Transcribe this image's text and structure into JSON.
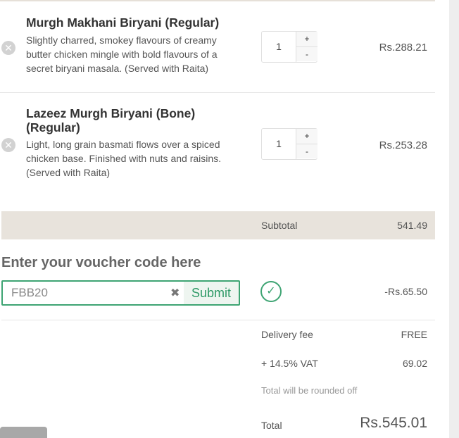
{
  "cart": {
    "items": [
      {
        "title": "Murgh Makhani Biryani (Regular)",
        "description": "Slightly charred, smokey flavours of creamy butter chicken mingle with bold flavours of a secret biryani masala. (Served with Raita)",
        "quantity": "1",
        "price": "Rs.288.21",
        "plus": "+",
        "minus": "-",
        "remove_icon": "close-circle-icon"
      },
      {
        "title": "Lazeez Murgh Biryani (Bone) (Regular)",
        "description": "Light, long grain basmati flows over a spiced chicken base. Finished with nuts and raisins. (Served with Raita)",
        "quantity": "1",
        "price": "Rs.253.28",
        "plus": "+",
        "minus": "-",
        "remove_icon": "close-circle-icon"
      }
    ],
    "subtotal": {
      "label": "Subtotal",
      "value": "541.49"
    }
  },
  "voucher": {
    "heading": "Enter your voucher code here",
    "code": "FBB20",
    "clear_glyph": "✖",
    "submit_label": "Submit",
    "applied_icon": "check-circle-icon",
    "check_glyph": "✓",
    "discount": "-Rs.65.50"
  },
  "summary": {
    "delivery_label": "Delivery fee",
    "delivery_value": "FREE",
    "vat_label": "+ 14.5% VAT",
    "vat_value": "69.02",
    "round_note": "Total will be rounded off",
    "total_label": "Total",
    "total_value": "Rs.545.01"
  },
  "colors": {
    "accent_green": "#3ea473",
    "subtotal_bg": "#e8e3dc"
  }
}
